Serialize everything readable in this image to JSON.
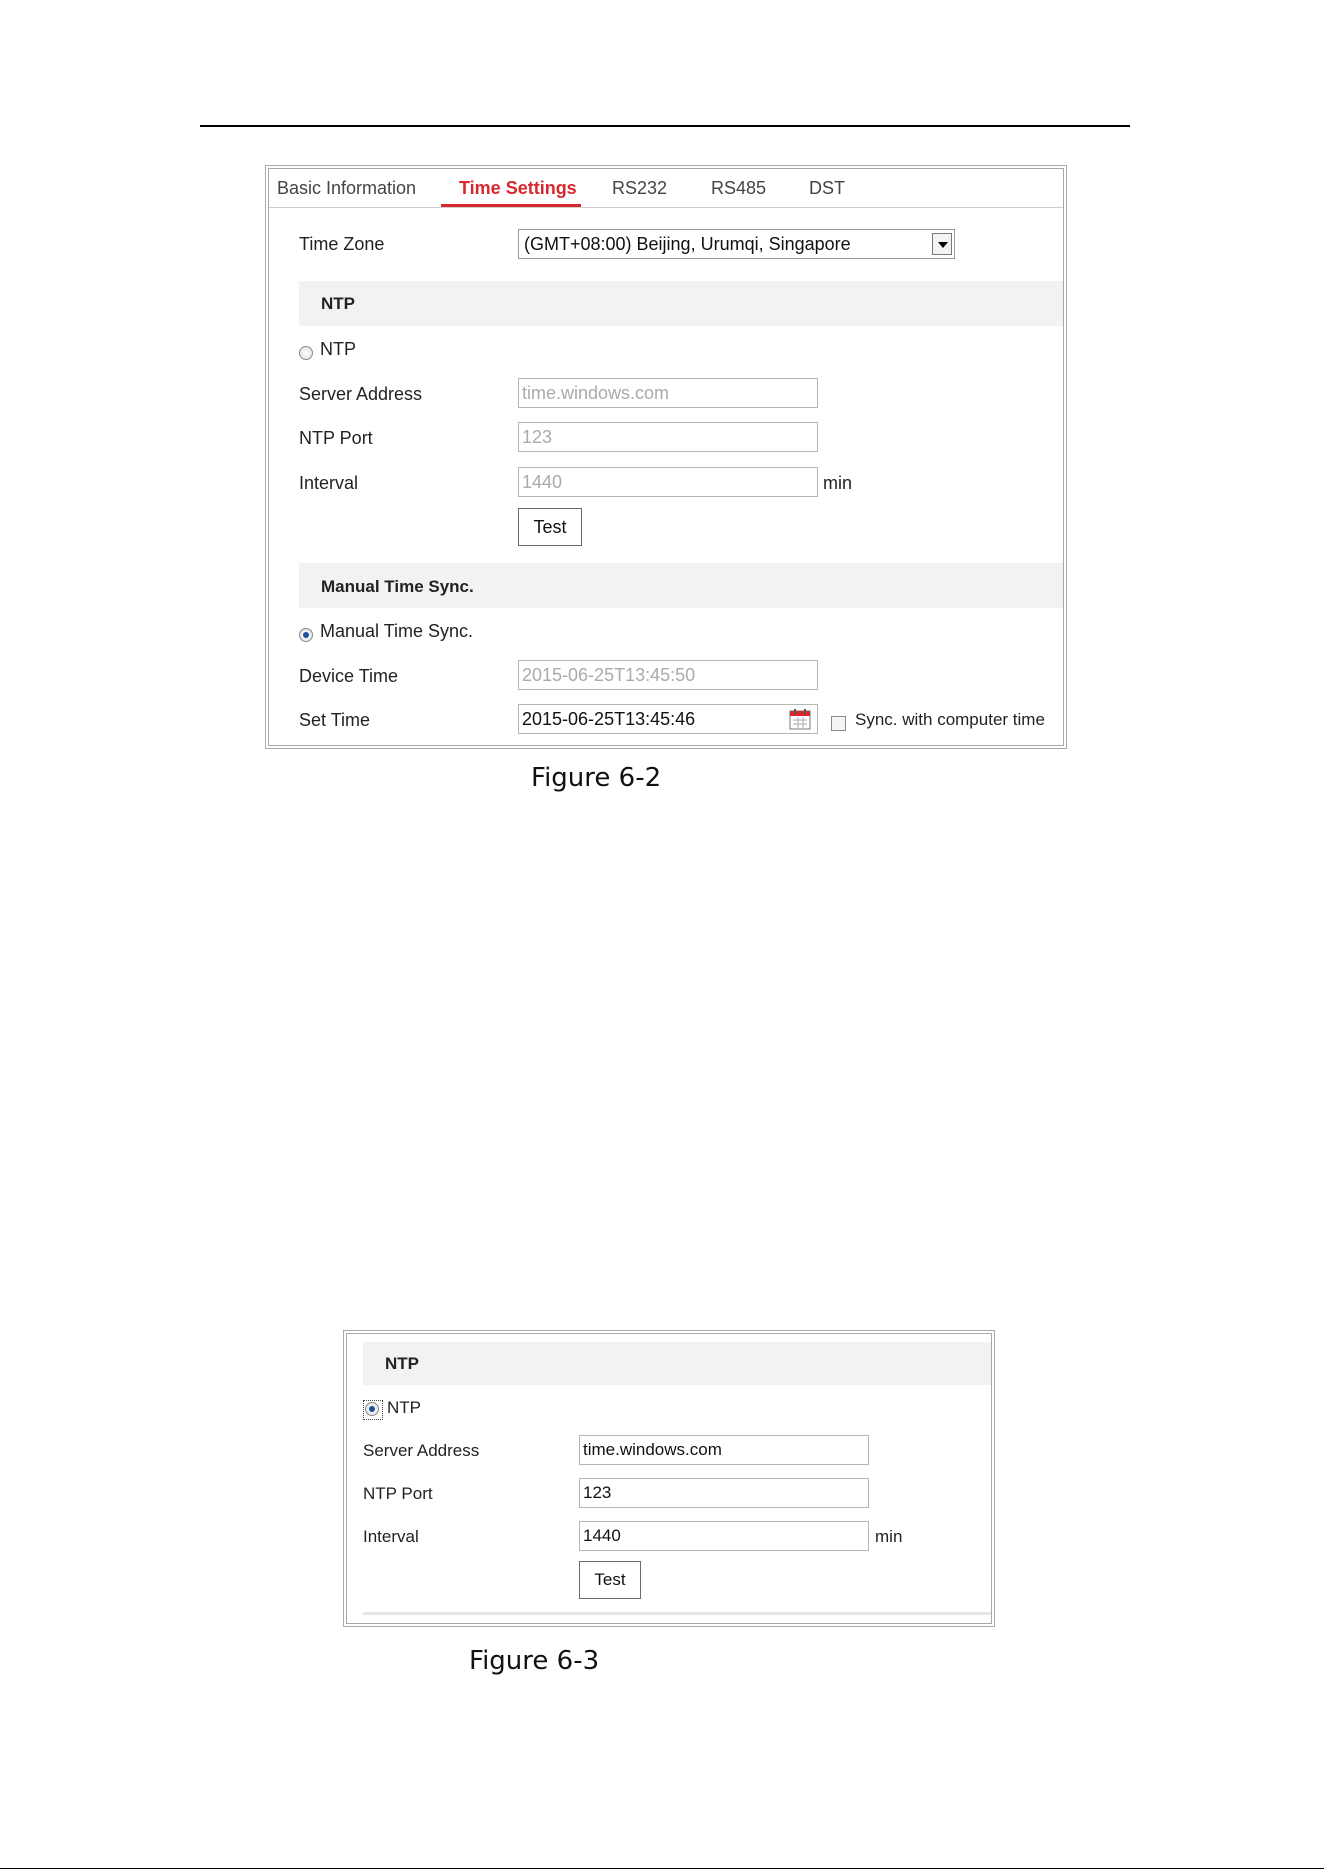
{
  "fig1": {
    "tabs": [
      {
        "label": "Basic Information",
        "active": false
      },
      {
        "label": "Time Settings",
        "active": true
      },
      {
        "label": "RS232",
        "active": false
      },
      {
        "label": "RS485",
        "active": false
      },
      {
        "label": "DST",
        "active": false
      }
    ],
    "time_zone_label": "Time Zone",
    "time_zone_value": "(GMT+08:00) Beijing, Urumqi, Singapore",
    "ntp_section": "NTP",
    "ntp_radio_label": "NTP",
    "server_address_label": "Server Address",
    "server_address_value": "time.windows.com",
    "ntp_port_label": "NTP Port",
    "ntp_port_value": "123",
    "interval_label": "Interval",
    "interval_value": "1440",
    "interval_unit": "min",
    "test_button": "Test",
    "manual_section": "Manual Time Sync.",
    "manual_radio_label": "Manual Time Sync.",
    "device_time_label": "Device Time",
    "device_time_value": "2015-06-25T13:45:50",
    "set_time_label": "Set Time",
    "set_time_value": "2015-06-25T13:45:46",
    "sync_label": "Sync. with computer time",
    "caption": "Figure 6-2"
  },
  "fig2": {
    "ntp_section": "NTP",
    "ntp_radio_label": "NTP",
    "server_address_label": "Server Address",
    "server_address_value": "time.windows.com",
    "ntp_port_label": "NTP Port",
    "ntp_port_value": "123",
    "interval_label": "Interval",
    "interval_value": "1440",
    "interval_unit": "min",
    "test_button": "Test",
    "caption": "Figure 6-3"
  },
  "colors": {
    "accent": "#d9272e",
    "band": "#f2f2f2"
  }
}
